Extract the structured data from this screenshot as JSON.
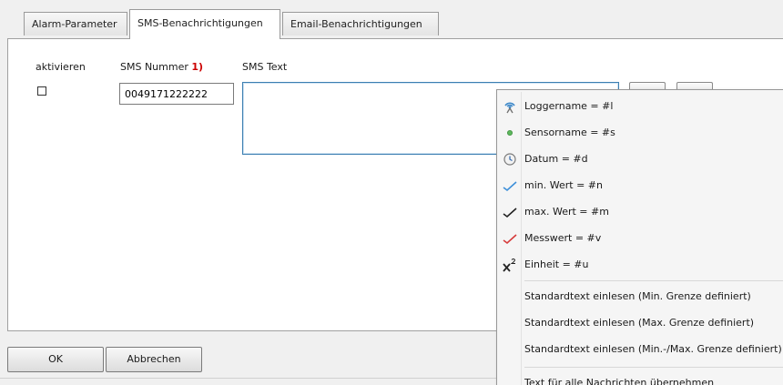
{
  "tabs": [
    {
      "label": "Alarm-Parameter",
      "active": false
    },
    {
      "label": "SMS-Benachrichtigungen",
      "active": true
    },
    {
      "label": "Email-Benachrichtigungen",
      "active": false
    }
  ],
  "form": {
    "activate_label": "aktivieren",
    "sms_number_label": "SMS Nummer",
    "sms_number_footnote": "1)",
    "sms_text_label": "SMS Text",
    "sms_number_value": "0049171222222",
    "sms_text_value": "",
    "activate_checked": false
  },
  "buttons": {
    "ok": "OK",
    "cancel": "Abbrechen"
  },
  "menu": {
    "placeholders": [
      {
        "label": "Loggername = #l",
        "icon": "antenna-icon"
      },
      {
        "label": "Sensorname = #s",
        "icon": "sensor-dot-icon"
      },
      {
        "label": "Datum = #d",
        "icon": "clock-icon"
      },
      {
        "label": "min. Wert = #n",
        "icon": "min-value-icon"
      },
      {
        "label": "max. Wert = #m",
        "icon": "max-value-icon"
      },
      {
        "label": "Messwert = #v",
        "icon": "measured-value-icon"
      },
      {
        "label": "Einheit = #u",
        "icon": "unit-superscript-icon"
      }
    ],
    "standard_texts": [
      "Standardtext einlesen (Min. Grenze definiert)",
      "Standardtext einlesen (Max. Grenze definiert)",
      "Standardtext einlesen (Min.-/Max. Grenze definiert)"
    ],
    "apply_all": "Text für alle Nachrichten übernehmen"
  },
  "colors": {
    "accent_border": "#3c7fb1",
    "footnote_red": "#cc0000"
  }
}
